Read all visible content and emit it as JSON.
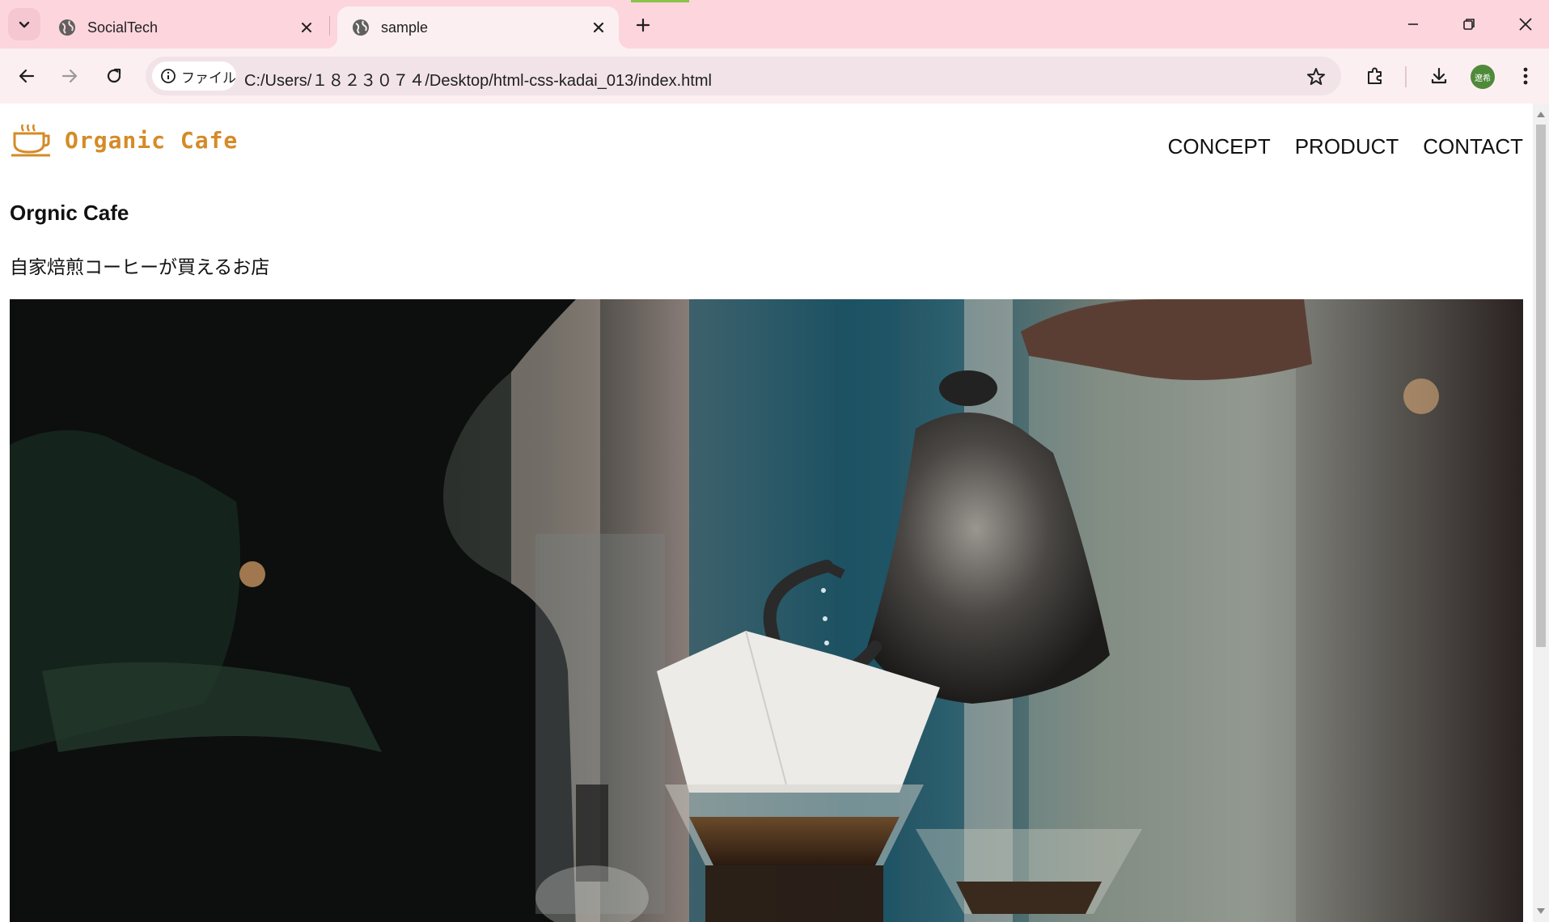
{
  "browser": {
    "tabs": [
      {
        "title": "SocialTech",
        "active": false
      },
      {
        "title": "sample",
        "active": true
      }
    ],
    "address_chip": "ファイル",
    "url": "C:/Users/１８２３０７４/Desktop/html-css-kadai_013/index.html",
    "profile_label": "遼希"
  },
  "site": {
    "logo_text": "Organic Cafe",
    "nav": [
      "CONCEPT",
      "PRODUCT",
      "CONTACT"
    ],
    "hero_title": "Orgnic Cafe",
    "hero_subtitle": "自家焙煎コーヒーが買えるお店"
  },
  "colors": {
    "tabbar_bg": "#fdd5dd",
    "toolbar_bg": "#fbeff2",
    "logo_orange": "#d48b28"
  }
}
